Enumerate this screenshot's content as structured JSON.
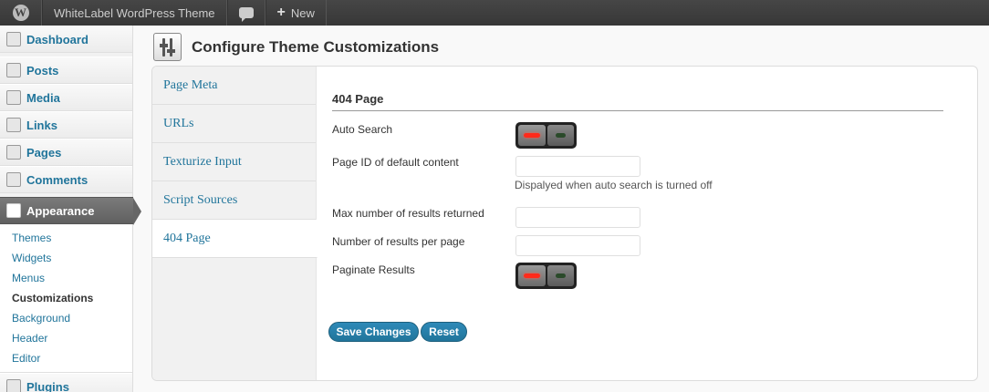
{
  "adminbar": {
    "logo": "W",
    "site_name": "WhiteLabel WordPress Theme",
    "new_label": "New"
  },
  "sidebar": {
    "top_items": [
      {
        "label": "Dashboard",
        "icon": "home-icon"
      },
      {
        "label": "Posts",
        "icon": "pushpin-icon"
      },
      {
        "label": "Media",
        "icon": "media-icon"
      },
      {
        "label": "Links",
        "icon": "link-icon"
      },
      {
        "label": "Pages",
        "icon": "page-icon"
      },
      {
        "label": "Comments",
        "icon": "comment-icon"
      }
    ],
    "current": {
      "label": "Appearance",
      "icon": "appearance-icon"
    },
    "submenu": [
      "Themes",
      "Widgets",
      "Menus",
      "Customizations",
      "Background",
      "Header",
      "Editor"
    ],
    "next_item": {
      "label": "Plugins",
      "icon": "plugin-icon"
    }
  },
  "page": {
    "title": "Configure Theme Customizations"
  },
  "tabs": [
    "Page Meta",
    "URLs",
    "Texturize Input",
    "Script Sources",
    "404 Page"
  ],
  "active_tab": "404 Page",
  "section": {
    "title": "404 Page",
    "auto_search_label": "Auto Search",
    "auto_search_value": "off",
    "page_id_label": "Page ID of default content",
    "page_id_value": "",
    "page_id_desc": "Dispalyed when auto search is turned off",
    "max_results_label": "Max number of results returned",
    "max_results_value": "",
    "per_page_label": "Number of results per page",
    "per_page_value": "",
    "paginate_label": "Paginate Results",
    "paginate_value": "off"
  },
  "buttons": {
    "save": "Save Changes",
    "reset": "Reset"
  },
  "colors": {
    "link": "#21759b",
    "led_off_red": "#ff2a1a",
    "led_on_green": "#2a4a2a"
  }
}
